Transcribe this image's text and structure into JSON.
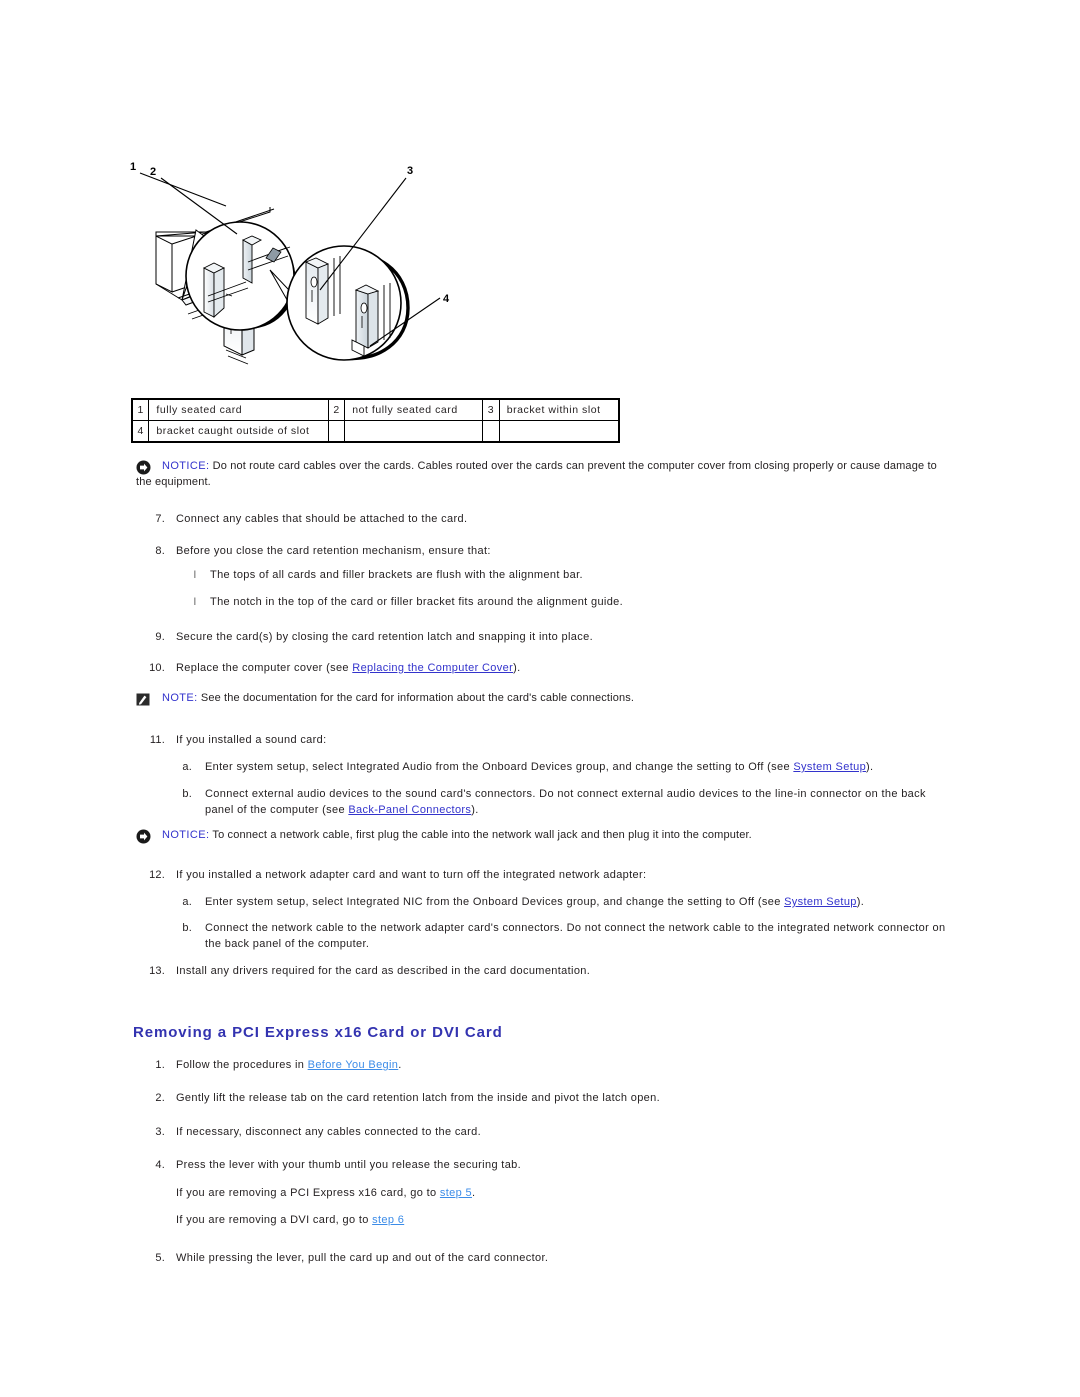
{
  "figure": {
    "name": "card-seating-illustration",
    "callout_numbers": [
      "1",
      "2",
      "3",
      "4"
    ]
  },
  "callout_table": {
    "rows": [
      [
        {
          "num": "1",
          "label": "fully seated card"
        },
        {
          "num": "2",
          "label": "not fully seated card"
        },
        {
          "num": "3",
          "label": "bracket within slot"
        }
      ],
      [
        {
          "num": "4",
          "label": "bracket caught outside of slot"
        },
        {
          "num": "",
          "label": ""
        },
        {
          "num": "",
          "label": ""
        }
      ]
    ]
  },
  "notice_1": {
    "icon": "notice-arrow-icon",
    "keyword": "NOTICE:",
    "text": " Do not route card cables over the cards. Cables routed over the cards can prevent the computer cover from closing properly or cause damage to the equipment."
  },
  "note_1": {
    "icon": "note-pencil-icon",
    "keyword": "NOTE:",
    "text": " See the documentation for the card for information about the card's cable connections."
  },
  "notice_2": {
    "icon": "notice-arrow-icon",
    "keyword": "NOTICE:",
    "text": " To connect a network cable, first plug the cable into the network wall jack and then plug it into the computer."
  },
  "install_steps": {
    "step7": {
      "num": "7.",
      "text": "Connect any cables that should be attached to the card."
    },
    "step8": {
      "num": "8.",
      "text": "Before you close the card retention mechanism, ensure that:"
    },
    "step8_bullets": [
      {
        "marker": "l",
        "text": "The tops of all cards and filler brackets are flush with the alignment bar."
      },
      {
        "marker": "l",
        "text": "The notch in the top of the card or filler bracket fits around the alignment guide."
      }
    ],
    "step9": {
      "num": "9.",
      "text": "Secure the card(s) by closing the card retention latch and snapping it into place."
    },
    "step10": {
      "num": "10.",
      "pre": "Replace the computer cover (see ",
      "link": "Replacing the Computer Cover",
      "post": ")."
    },
    "step11": {
      "num": "11.",
      "text": "If you installed a sound card:"
    },
    "step11a": {
      "num": "a.",
      "pre": "Enter system setup, select Integrated Audio from the Onboard Devices group, and change the setting to Off (see ",
      "link": "System Setup",
      "post": ")."
    },
    "step11b": {
      "num": "b.",
      "pre": "Connect external audio devices to the sound card's connectors. Do not connect external audio devices to the line-in connector on the back panel of the computer (see ",
      "link": "Back-Panel Connectors",
      "post": ")."
    },
    "step12": {
      "num": "12.",
      "text": "If you installed a network adapter card and want to turn off the integrated network adapter:"
    },
    "step12a": {
      "num": "a.",
      "pre": "Enter system setup, select Integrated NIC from the Onboard Devices group, and change the setting to Off (see ",
      "link": "System Setup",
      "post": ")."
    },
    "step12b": {
      "num": "b.",
      "text": "Connect the network cable to the network adapter card's connectors. Do not connect the network cable to the integrated network connector on the back panel of the computer."
    },
    "step13": {
      "num": "13.",
      "text": "Install any drivers required for the card as described in the card documentation."
    }
  },
  "section": {
    "heading": "Removing a PCI Express x16 Card or DVI Card"
  },
  "remove_steps": {
    "step1": {
      "num": "1.",
      "pre": "Follow the procedures in ",
      "link": "Before You Begin",
      "post": "."
    },
    "step2": {
      "num": "2.",
      "text": "Gently lift the release tab on the card retention latch from the inside and pivot the latch open."
    },
    "step3": {
      "num": "3.",
      "text": "If necessary, disconnect any cables connected to the card."
    },
    "step4": {
      "num": "4.",
      "text": "Press the lever with your thumb until you release the securing tab."
    },
    "note_x16": {
      "pre": "If you are removing a PCI Express x16 card, go to ",
      "link": "step 5",
      "post": "."
    },
    "note_dvi": {
      "pre": "If you are removing a DVI card, go to ",
      "link": "step 6",
      "post": ""
    },
    "step5": {
      "num": "5.",
      "text": "While pressing the lever, pull the card up and out of the card connector."
    }
  },
  "colors": {
    "link_dark": "#3333cc",
    "link_light": "#3c8ce8",
    "heading": "#3333b0",
    "text": "#231f20"
  }
}
